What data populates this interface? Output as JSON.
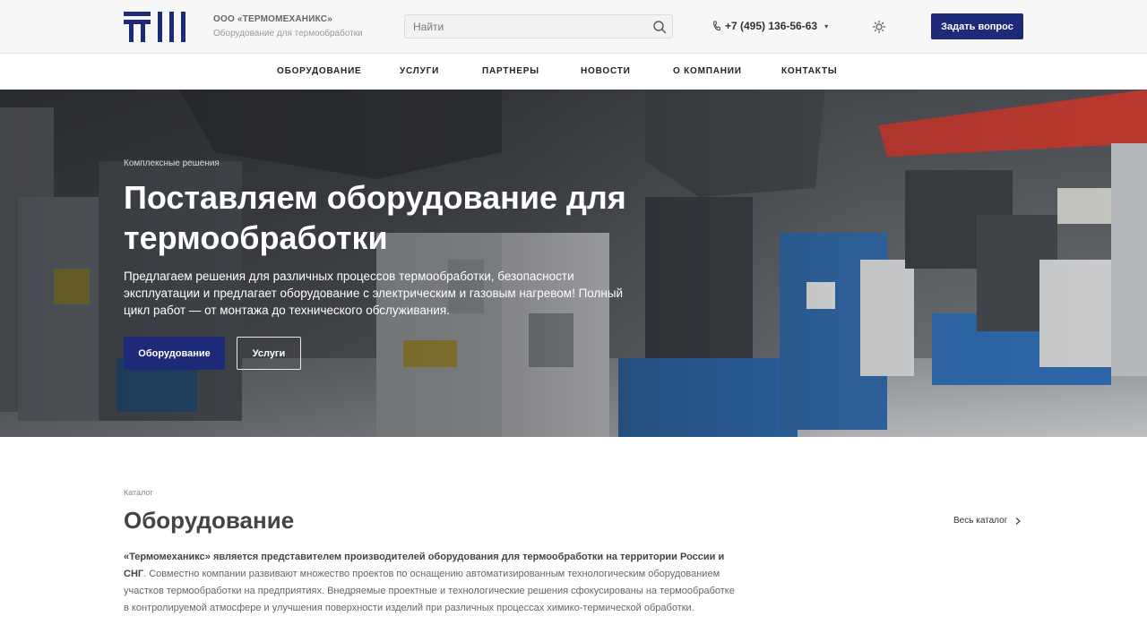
{
  "header": {
    "company_name": "ООО «ТЕРМОМЕХАНИКС»",
    "company_subtitle": "Оборудование для термообработки",
    "search_placeholder": "Найти",
    "phone": "+7 (495) 136-56-63",
    "ask_button": "Задать вопрос",
    "brand_color": "#1d2a78"
  },
  "nav": {
    "items": [
      "Оборудование",
      "Услуги",
      "Партнеры",
      "Новости",
      "О компании",
      "Контакты"
    ]
  },
  "hero": {
    "kicker": "Комплексные решения",
    "title": "Поставляем оборудование для термообработки",
    "text": "Предлагаем решения для различных процессов термообработки, безопасности эксплуатации и предлагает оборудование с электрическим и газовым нагревом! Полный цикл работ — от монтажа до технического обслуживания.",
    "primary_button": "Оборудование",
    "secondary_button": "Услуги"
  },
  "catalog": {
    "kicker": "Каталог",
    "title": "Оборудование",
    "all_link": "Весь каталог",
    "desc_bold": "«Термомеханикс» является представителем производителей оборудования для термообработки на территории России и СНГ",
    "desc_rest": ". Совместно компании развивают множество проектов по оснащению автоматизированным технологическим оборудованием участков термообработки на предприятиях. Внедряемые проектные и технологические решения сфокусированы на термообработке в контролируемой атмосфере и улучшения поверхности изделий при различных процессах химико-термической обработки."
  }
}
